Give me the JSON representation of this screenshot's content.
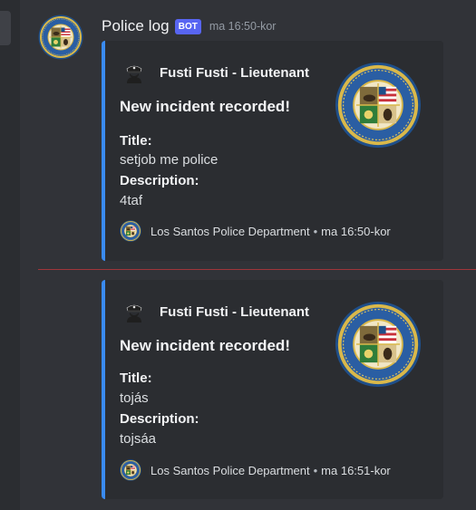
{
  "message": {
    "author": "Police log",
    "bot_badge": "BOT",
    "timestamp": "ma 16:50-kor"
  },
  "embeds": [
    {
      "author_name": "Fusti Fusti - Lieutenant",
      "title": "New incident recorded!",
      "fields": [
        {
          "name": "Title:",
          "value": "setjob me police"
        },
        {
          "name": "Description:",
          "value": "4taf"
        }
      ],
      "footer_text": "Los Santos Police Department",
      "footer_separator": "•",
      "footer_time": "ma 16:50-kor"
    },
    {
      "author_name": "Fusti Fusti - Lieutenant",
      "title": "New incident recorded!",
      "fields": [
        {
          "name": "Title:",
          "value": "tojás"
        },
        {
          "name": "Description:",
          "value": "tojsáa"
        }
      ],
      "footer_text": "Los Santos Police Department",
      "footer_separator": "•",
      "footer_time": "ma 16:51-kor"
    }
  ],
  "seal_text": "CITY OF LOS SANTOS · FOUNDED 1781",
  "colors": {
    "background": "#313338",
    "embed_background": "#2b2d31",
    "embed_accent": "#3a8bf0",
    "bot_badge": "#5865f2",
    "new_message_divider": "#a0353a"
  },
  "icons": {
    "avatar": "city-seal-icon",
    "embed_author": "police-officer-icon",
    "thumbnail": "city-seal-icon",
    "footer": "city-seal-icon"
  }
}
